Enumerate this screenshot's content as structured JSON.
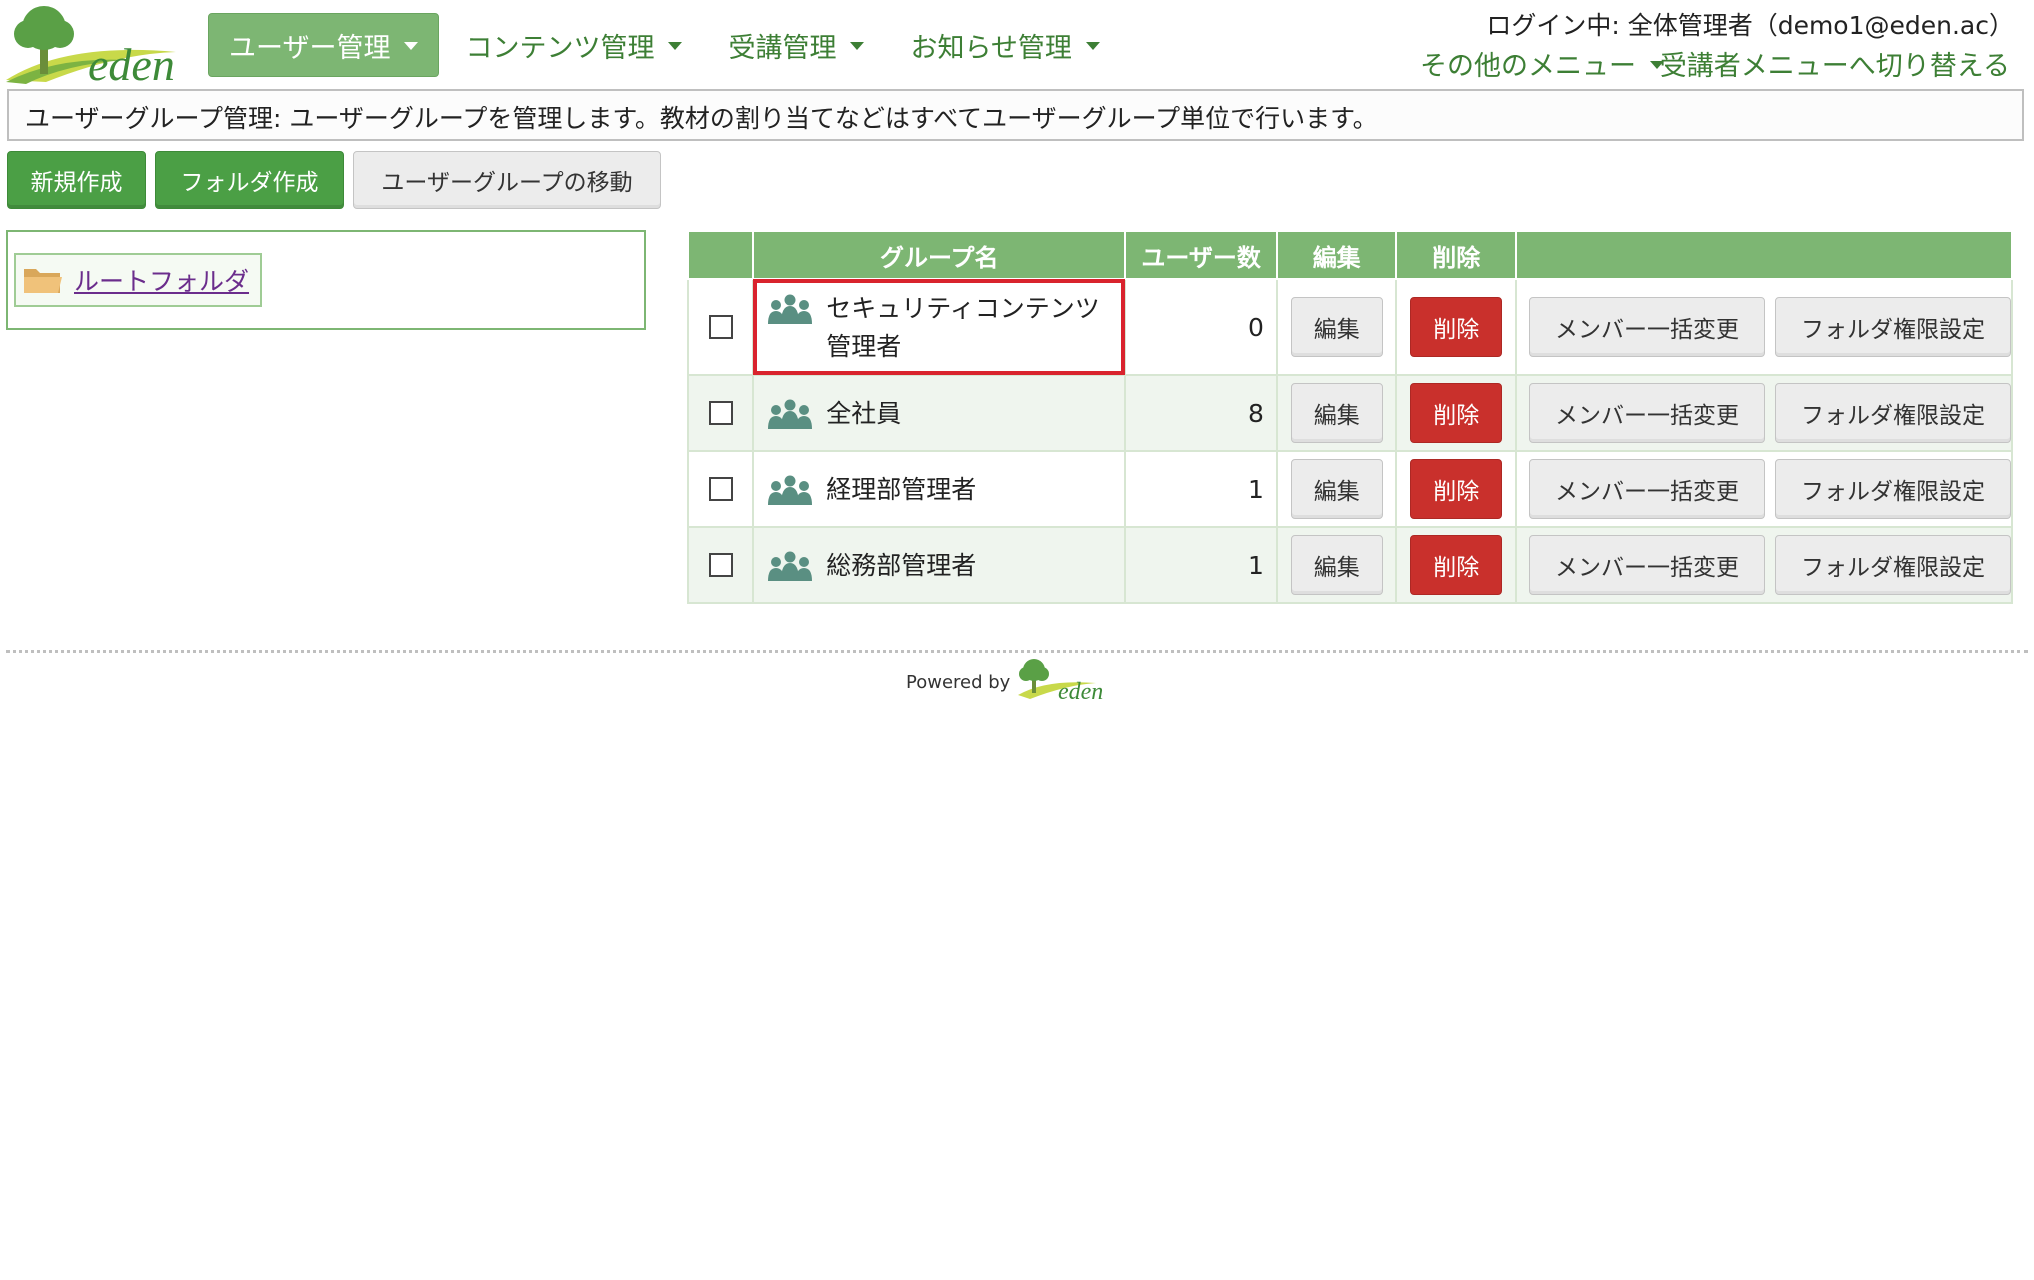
{
  "header": {
    "logo_text": "eden",
    "nav": [
      {
        "label": "ユーザー管理"
      },
      {
        "label": "コンテンツ管理"
      },
      {
        "label": "受講管理"
      },
      {
        "label": "お知らせ管理"
      }
    ],
    "login_info": "ログイン中: 全体管理者（demo1@eden.ac）",
    "other_menu": "その他のメニュー",
    "switch_menu": "受講者メニューへ切り替える"
  },
  "description": "ユーザーグループ管理: ユーザーグループを管理します。教材の割り当てなどはすべてユーザーグループ単位で行います。",
  "toolbar": {
    "new_label": "新規作成",
    "folder_label": "フォルダ作成",
    "move_label": "ユーザーグループの移動"
  },
  "tree": {
    "root_label": "ルートフォルダ"
  },
  "table": {
    "headers": {
      "group_name": "グループ名",
      "user_count": "ユーザー数",
      "edit": "編集",
      "delete": "削除"
    },
    "button_labels": {
      "edit": "編集",
      "delete": "削除",
      "bulk_member": "メンバー一括変更",
      "folder_perm": "フォルダ権限設定"
    },
    "rows": [
      {
        "name": "セキュリティコンテンツ管理者",
        "count": "0"
      },
      {
        "name": "全社員",
        "count": "8"
      },
      {
        "name": "経理部管理者",
        "count": "1"
      },
      {
        "name": "総務部管理者",
        "count": "1"
      }
    ]
  },
  "footer": {
    "powered_by": "Powered by",
    "logo_text": "eden"
  },
  "colors": {
    "primary_green": "#4b9f45",
    "nav_green": "#3d7f35",
    "header_green": "#7db673",
    "danger_red": "#c9302c",
    "highlight_red": "#d9232d"
  }
}
